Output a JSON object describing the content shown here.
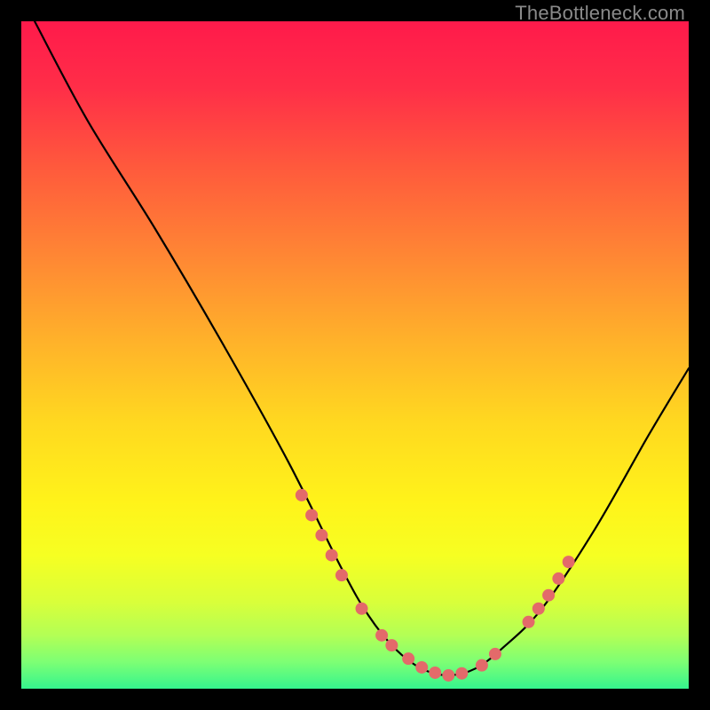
{
  "watermark": "TheBottleneck.com",
  "gradient": {
    "stops": [
      {
        "offset": "0%",
        "color": "#ff1a4b"
      },
      {
        "offset": "10%",
        "color": "#ff2e48"
      },
      {
        "offset": "22%",
        "color": "#ff5a3c"
      },
      {
        "offset": "35%",
        "color": "#ff8634"
      },
      {
        "offset": "48%",
        "color": "#ffb22a"
      },
      {
        "offset": "60%",
        "color": "#ffd820"
      },
      {
        "offset": "72%",
        "color": "#fff31a"
      },
      {
        "offset": "80%",
        "color": "#f6ff22"
      },
      {
        "offset": "87%",
        "color": "#d9ff3a"
      },
      {
        "offset": "92%",
        "color": "#b3ff55"
      },
      {
        "offset": "96%",
        "color": "#7dff74"
      },
      {
        "offset": "100%",
        "color": "#35f58e"
      }
    ]
  },
  "chart_data": {
    "type": "line",
    "title": "",
    "xlabel": "",
    "ylabel": "",
    "xlim": [
      0,
      100
    ],
    "ylim": [
      0,
      100
    ],
    "series": [
      {
        "name": "bottleneck-curve",
        "x": [
          2,
          10,
          20,
          30,
          40,
          48,
          52,
          56,
          60,
          64,
          68,
          72,
          78,
          86,
          94,
          100
        ],
        "values": [
          100,
          85,
          69,
          52,
          34,
          18,
          11,
          6,
          3,
          2,
          3,
          6,
          12,
          24,
          38,
          48
        ]
      }
    ],
    "markers": {
      "name": "highlight-dots",
      "color": "#e36a6a",
      "radius": 7,
      "points": [
        {
          "x": 42,
          "y": 29
        },
        {
          "x": 43.5,
          "y": 26
        },
        {
          "x": 45,
          "y": 23
        },
        {
          "x": 46.5,
          "y": 20
        },
        {
          "x": 48,
          "y": 17
        },
        {
          "x": 51,
          "y": 12
        },
        {
          "x": 54,
          "y": 8
        },
        {
          "x": 55.5,
          "y": 6.5
        },
        {
          "x": 58,
          "y": 4.5
        },
        {
          "x": 60,
          "y": 3.2
        },
        {
          "x": 62,
          "y": 2.4
        },
        {
          "x": 64,
          "y": 2.0
        },
        {
          "x": 66,
          "y": 2.3
        },
        {
          "x": 69,
          "y": 3.5
        },
        {
          "x": 71,
          "y": 5.2
        },
        {
          "x": 76,
          "y": 10
        },
        {
          "x": 77.5,
          "y": 12
        },
        {
          "x": 79,
          "y": 14
        },
        {
          "x": 80.5,
          "y": 16.5
        },
        {
          "x": 82,
          "y": 19
        }
      ]
    }
  }
}
